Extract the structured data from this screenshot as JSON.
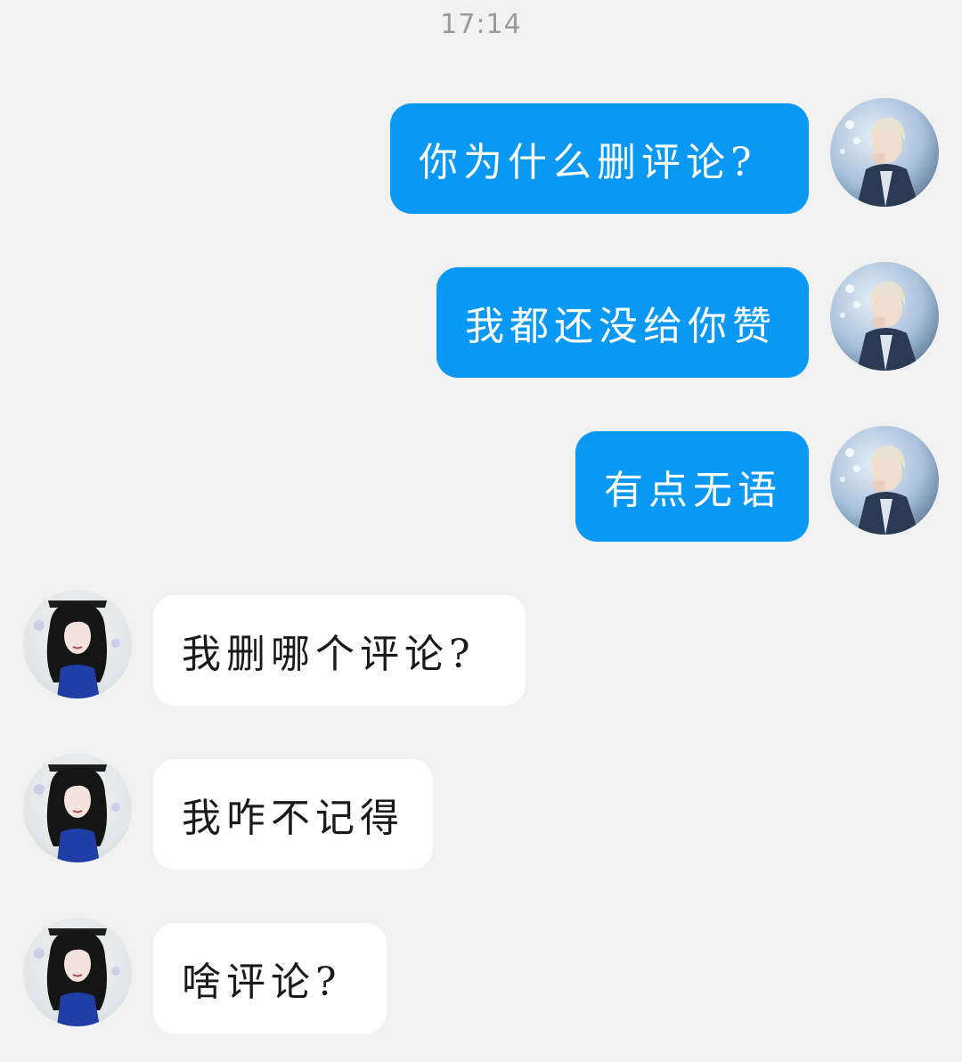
{
  "status": {
    "time": "17:14"
  },
  "colors": {
    "background": "#f1f1f1",
    "outgoing_bubble": "#0a98f5",
    "incoming_bubble": "#ffffff",
    "timestamp": "#9a9a9a"
  },
  "messages": [
    {
      "direction": "outgoing",
      "avatar": "male-avatar-icon",
      "text": "你为什么删评论?"
    },
    {
      "direction": "outgoing",
      "avatar": "male-avatar-icon",
      "text": "我都还没给你赞"
    },
    {
      "direction": "outgoing",
      "avatar": "male-avatar-icon",
      "text": "有点无语"
    },
    {
      "direction": "incoming",
      "avatar": "female-avatar-icon",
      "text": "我删哪个评论?"
    },
    {
      "direction": "incoming",
      "avatar": "female-avatar-icon",
      "text": "我咋不记得"
    },
    {
      "direction": "incoming",
      "avatar": "female-avatar-icon",
      "text": "啥评论?"
    }
  ]
}
